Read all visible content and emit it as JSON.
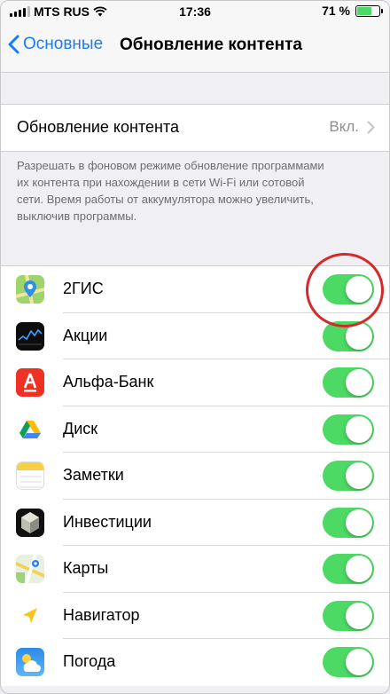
{
  "status_bar": {
    "carrier": "MTS RUS",
    "time": "17:36",
    "battery_percent_text": "71 %",
    "battery_level": 0.71
  },
  "nav": {
    "back_label": "Основные",
    "title": "Обновление контента"
  },
  "setting": {
    "label": "Обновление контента",
    "value": "Вкл."
  },
  "footer_text": "Разрешать в фоновом режиме обновление программами их контента при нахождении в сети Wi-Fi или сотовой сети. Время работы от аккумулятора можно увеличить, выключив программы.",
  "apps": [
    {
      "name": "2ГИС",
      "icon": "2gis-icon",
      "enabled": true
    },
    {
      "name": "Акции",
      "icon": "stocks-icon",
      "enabled": true
    },
    {
      "name": "Альфа-Банк",
      "icon": "alfa-bank-icon",
      "enabled": true
    },
    {
      "name": "Диск",
      "icon": "drive-icon",
      "enabled": true
    },
    {
      "name": "Заметки",
      "icon": "notes-icon",
      "enabled": true
    },
    {
      "name": "Инвестиции",
      "icon": "investments-icon",
      "enabled": true
    },
    {
      "name": "Карты",
      "icon": "maps-icon",
      "enabled": true
    },
    {
      "name": "Навигатор",
      "icon": "navigator-icon",
      "enabled": true
    },
    {
      "name": "Погода",
      "icon": "weather-icon",
      "enabled": true
    }
  ],
  "colors": {
    "accent": "#1a7cf5",
    "toggle_on": "#4cd964",
    "highlight": "#d42a2a"
  }
}
